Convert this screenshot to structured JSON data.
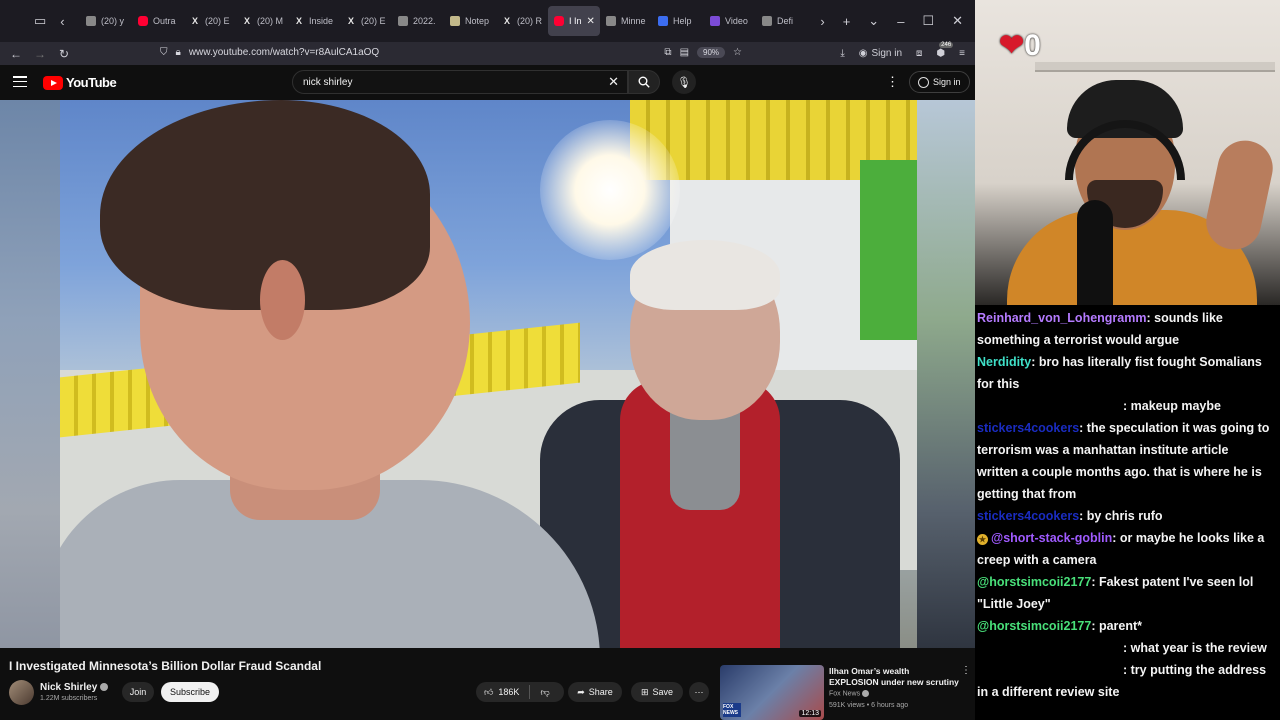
{
  "browser": {
    "tabs": [
      {
        "label": "(20) y",
        "icon": "tab-icon",
        "active": false
      },
      {
        "label": "Outra",
        "icon": "yt",
        "active": false
      },
      {
        "label": "(20) E",
        "icon": "x",
        "active": false
      },
      {
        "label": "(20) M",
        "icon": "x",
        "active": false
      },
      {
        "label": "Inside",
        "icon": "x",
        "active": false
      },
      {
        "label": "(20) E",
        "icon": "x",
        "active": false
      },
      {
        "label": "2022.",
        "icon": "doc",
        "active": false
      },
      {
        "label": "Notep",
        "icon": "note",
        "active": false
      },
      {
        "label": "(20) R",
        "icon": "x",
        "active": false
      },
      {
        "label": "I In",
        "icon": "yt",
        "active": true
      },
      {
        "label": "Minne",
        "icon": "doc",
        "active": false
      },
      {
        "label": "Help",
        "icon": "help",
        "active": false
      },
      {
        "label": "Video",
        "icon": "video",
        "active": false
      },
      {
        "label": "Defi",
        "icon": "doc",
        "active": false
      }
    ],
    "url": "www.youtube.com/watch?v=r8AulCA1aOQ",
    "zoom": "90%",
    "sign_in": "Sign in",
    "extension_badge": "246"
  },
  "youtube": {
    "logo_text": "YouTube",
    "search_value": "nick shirley",
    "sign_in": "Sign in",
    "video_title": "I Investigated Minnesota’s Billion Dollar Fraud Scandal",
    "channel_name": "Nick Shirley",
    "subscribers": "1.22M subscribers",
    "join_label": "Join",
    "subscribe_label": "Subscribe",
    "likes": "186K",
    "share_label": "Share",
    "save_label": "Save",
    "recommendation": {
      "title": "Ilhan Omar’s wealth EXPLOSION under new scrutiny",
      "channel": "Fox News",
      "meta": "591K views • 6 hours ago",
      "duration": "12:13",
      "thumb_badge": "FOX NEWS"
    }
  },
  "stream": {
    "heart_count": "0"
  },
  "chat": {
    "messages": [
      {
        "user": "Reinhard_von_Lohengramm",
        "color": "#b57bff",
        "badge": false,
        "text": ": sounds like something a terrorist would argue"
      },
      {
        "user": "Nerdidity",
        "color": "#3fe0c8",
        "badge": false,
        "text": ": bro has literally fist fought Somalians for this"
      },
      {
        "user": "",
        "color": "#000000",
        "badge": false,
        "text": ": makeup maybe"
      },
      {
        "user": "stickers4cookers",
        "color": "#1a2cc0",
        "badge": false,
        "text": ": the speculation it was going to terrorism was a manhattan institute article written a couple months ago. that is where he is getting that from"
      },
      {
        "user": "stickers4cookers",
        "color": "#1a2cc0",
        "badge": false,
        "text": ": by chris rufo"
      },
      {
        "user": "@short-stack-goblin",
        "color": "#a05bff",
        "badge": true,
        "text": ": or maybe he looks like a creep with a camera"
      },
      {
        "user": "@horstsimcoii2177",
        "color": "#49e07a",
        "badge": false,
        "text": ": Fakest patent I've seen lol \"Little Joey\""
      },
      {
        "user": "@horstsimcoii2177",
        "color": "#49e07a",
        "badge": false,
        "text": ": parent*"
      },
      {
        "user": "",
        "color": "#000000",
        "badge": false,
        "text": ": what year is the review"
      },
      {
        "user": "",
        "color": "#000000",
        "badge": false,
        "text": ": try putting the address in a different review site"
      }
    ]
  }
}
